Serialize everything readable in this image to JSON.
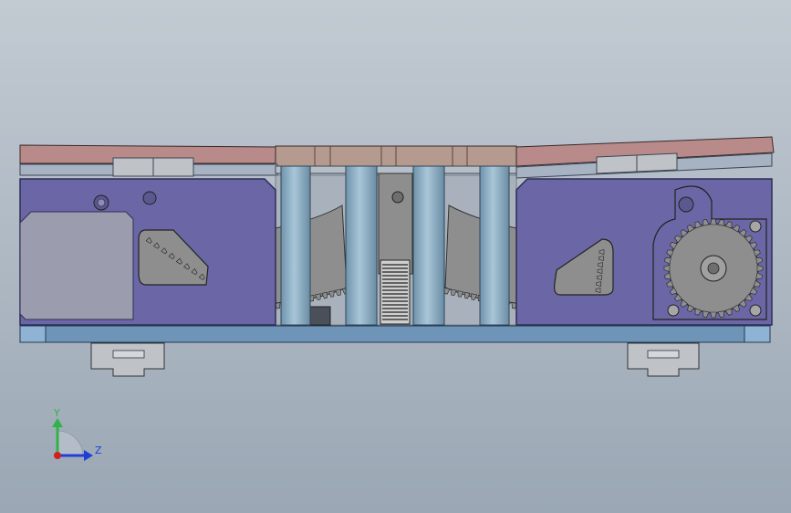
{
  "viewport": {
    "background_top": "#C2CAD2",
    "background_bottom": "#9AA7B4"
  },
  "assembly": {
    "colors": {
      "housing": "#6B67A6",
      "housing_edge": "#2E2C55",
      "top_plate": "#B88A8A",
      "top_plate_mid": "#B49A8F",
      "rail": "#A7B3C3",
      "base_plate": "#6E95B8",
      "base_plate_end": "#8FB3D4",
      "columns": "#8FB1C7",
      "gear_gray": "#8E8E8E",
      "motor": "#9B9DAE",
      "slider_block": "#BFC3C8"
    }
  },
  "triad": {
    "y_label": "Y",
    "z_label": "Z",
    "y_color": "#2FB34A",
    "z_color": "#1F3FD6",
    "origin_color": "#D41E1E"
  }
}
